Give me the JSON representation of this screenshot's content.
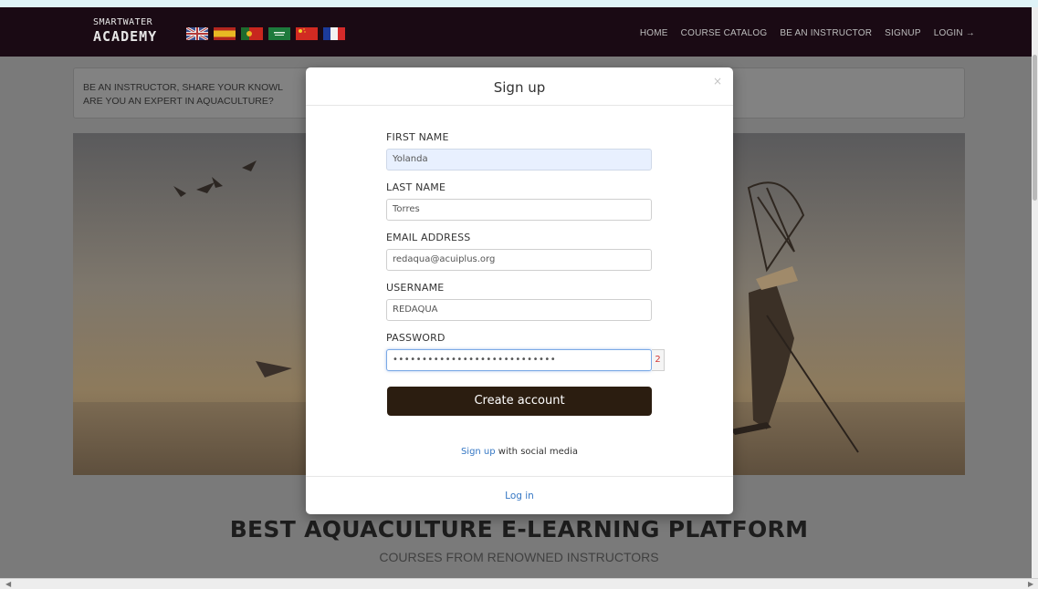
{
  "navbar": {
    "brand_line1": "SMARTWATER",
    "brand_line2": "ACADEMY",
    "links": [
      "HOME",
      "COURSE CATALOG",
      "BE AN INSTRUCTOR",
      "SIGNUP",
      "LOGIN →"
    ]
  },
  "flags": [
    "uk-flag-icon",
    "spain-flag-icon",
    "portugal-flag-icon",
    "saudi-flag-icon",
    "china-flag-icon",
    "france-flag-icon"
  ],
  "banner": {
    "line1": "BE AN INSTRUCTOR, SHARE YOUR KNOWL",
    "line2": "ARE YOU AN EXPERT IN AQUACULTURE?"
  },
  "hero": {
    "headline": "BEST AQUACULTURE E-LEARNING PLATFORM",
    "subline": "COURSES FROM RENOWNED INSTRUCTORS"
  },
  "modal": {
    "title": "Sign up",
    "close": "×",
    "fields": {
      "first_name": {
        "label": "FIRST NAME",
        "value": "Yolanda"
      },
      "last_name": {
        "label": "LAST NAME",
        "value": "Torres"
      },
      "email": {
        "label": "EMAIL ADDRESS",
        "value": "redaqua@acuiplus.org"
      },
      "username": {
        "label": "USERNAME",
        "value": "REDAQUA"
      },
      "password": {
        "label": "PASSWORD",
        "value": "••••••••••••••••••••••••••••",
        "badge": "2"
      }
    },
    "create_button": "Create account",
    "social_link": "Sign up",
    "social_text": " with social media",
    "login_link": "Log in"
  },
  "colors": {
    "navbar_bg": "#1a0a14",
    "button_bg": "#2b1d10",
    "link": "#3577c4",
    "overlay": "#7a7a7a"
  }
}
